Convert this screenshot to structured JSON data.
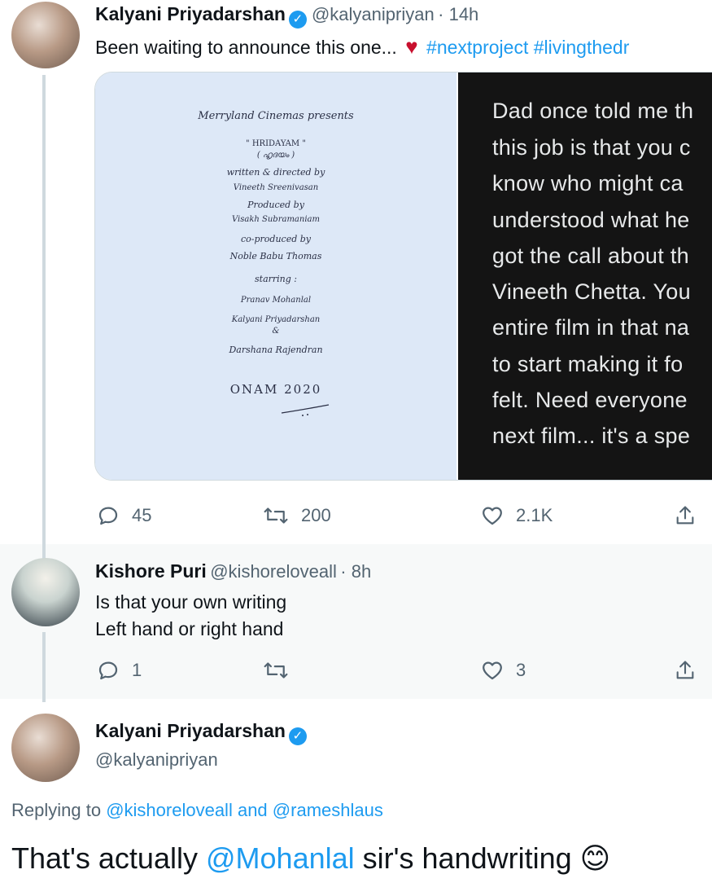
{
  "tweet1": {
    "name": "Kalyani Priyadarshan",
    "handle": "@kalyanipriyan",
    "time": "· 14h",
    "text": "Been waiting to announce this one...",
    "hashtags": "#nextproject #livingthedr",
    "heart_emoji": "♥",
    "media": {
      "poster_lines": [
        "Merryland Cinemas presents",
        "\" HRIDAYAM \"",
        "( ഹൃദയം )",
        "written & directed by",
        "Vineeth Sreenivasan",
        "Produced by",
        "Visakh Subramaniam",
        "co-produced by",
        "Noble Babu Thomas",
        "starring :",
        "Pranav Mohanlal",
        "Kalyani Priyadarshan",
        "&",
        "Darshana Rajendran",
        "ONAM 2020"
      ],
      "text_image_lines": [
        "Dad once told me th",
        "this job is that you c",
        "know who might ca",
        "understood what he",
        "got the call about th",
        "Vineeth Chetta. You",
        "entire film in that na",
        "to start making it fo",
        "felt. Need everyone",
        "next film... it's a spe"
      ]
    },
    "actions": {
      "reply_count": "45",
      "retweet_count": "200",
      "like_count": "2.1K"
    }
  },
  "reply": {
    "name": "Kishore Puri",
    "handle": "@kishoreloveall",
    "time": "· 8h",
    "line1": "Is that your own writing",
    "line2": "Left hand or right hand",
    "actions": {
      "reply_count": "1",
      "retweet_count": "",
      "like_count": "3"
    }
  },
  "main_tweet": {
    "name": "Kalyani Priyadarshan",
    "handle": "@kalyanipriyan",
    "replying_prefix": "Replying to",
    "replying_to_1": "@kishoreloveall",
    "replying_and": "and",
    "replying_to_2": "@rameshlaus",
    "text_before": "That's actually",
    "mention": "@Mohanlal",
    "text_after": "sir's handwriting",
    "emoji": "😊"
  },
  "colors": {
    "accent": "#1d9bf0",
    "heart": "#e0245e",
    "text": "#0f1419",
    "secondary": "#536471"
  },
  "icons": [
    "verified-badge-icon",
    "reply-icon",
    "retweet-icon",
    "like-icon",
    "share-icon",
    "heart-emoji-icon",
    "smiling-face-emoji-icon"
  ]
}
